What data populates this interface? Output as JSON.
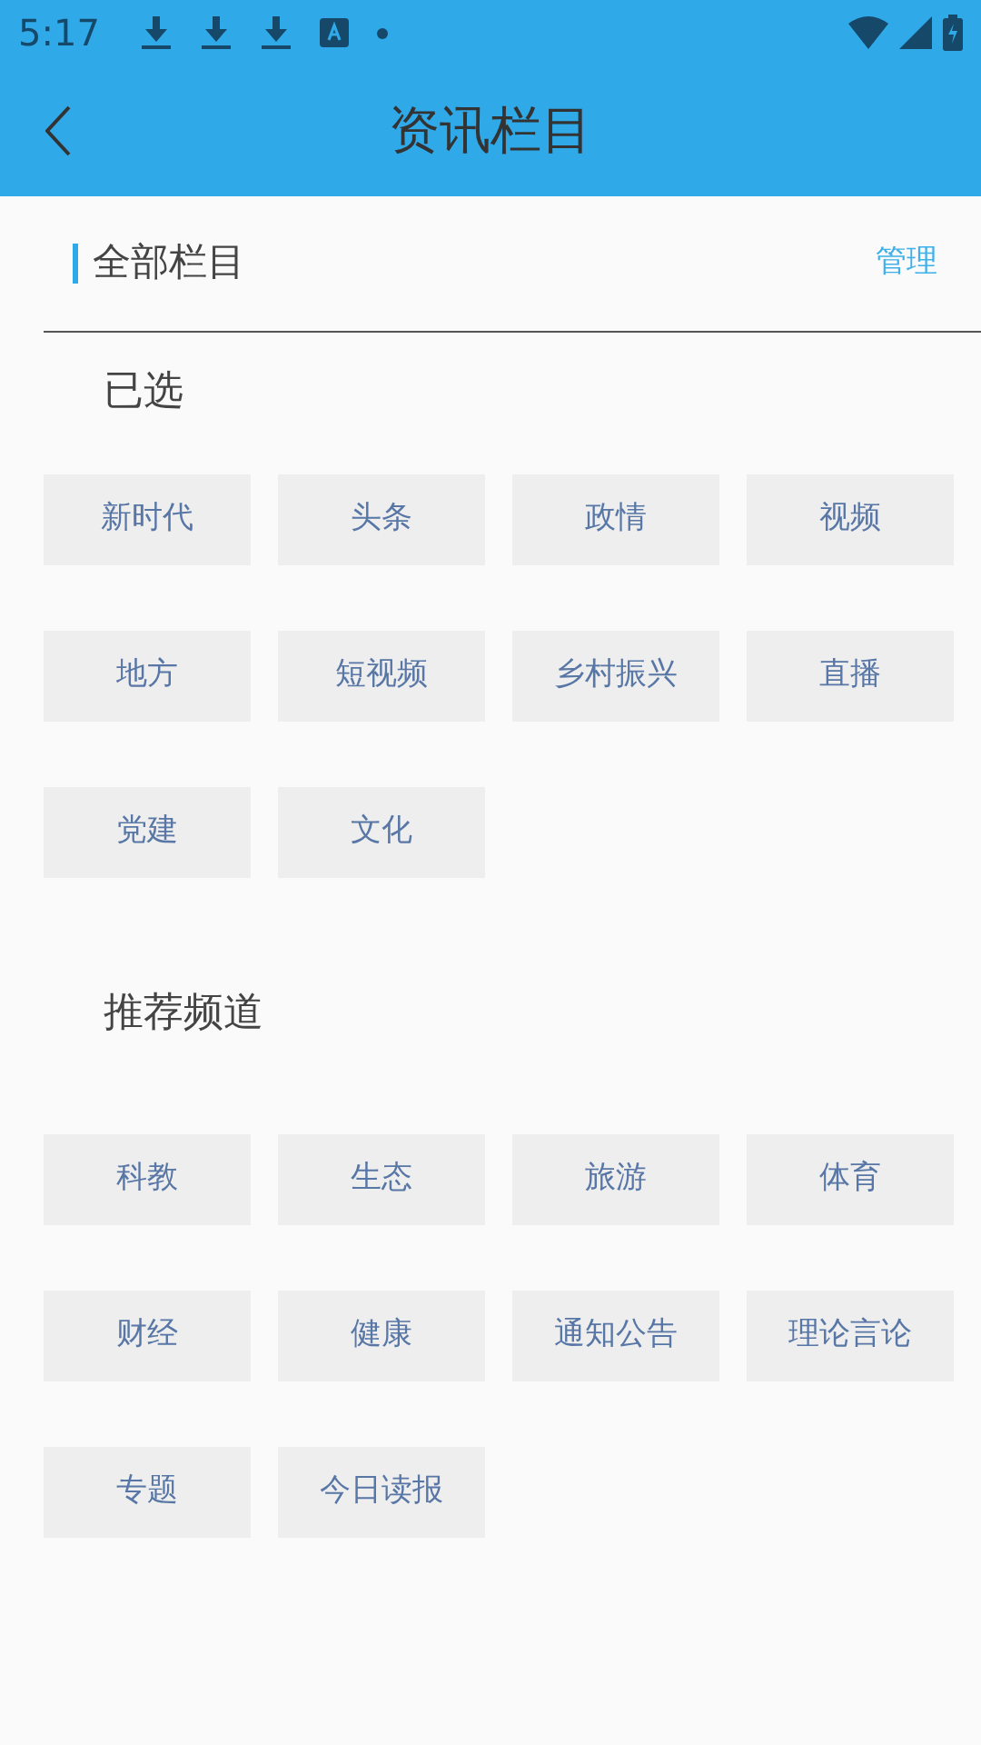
{
  "status_bar": {
    "time": "5:17"
  },
  "header": {
    "title": "资讯栏目"
  },
  "section": {
    "title": "全部栏目",
    "action": "管理"
  },
  "groups": [
    {
      "title": "已选",
      "items": [
        "新时代",
        "头条",
        "政情",
        "视频",
        "地方",
        "短视频",
        "乡村振兴",
        "直播",
        "党建",
        "文化"
      ]
    },
    {
      "title": "推荐频道",
      "items": [
        "科教",
        "生态",
        "旅游",
        "体育",
        "财经",
        "健康",
        "通知公告",
        "理论言论",
        "专题",
        "今日读报"
      ]
    }
  ]
}
